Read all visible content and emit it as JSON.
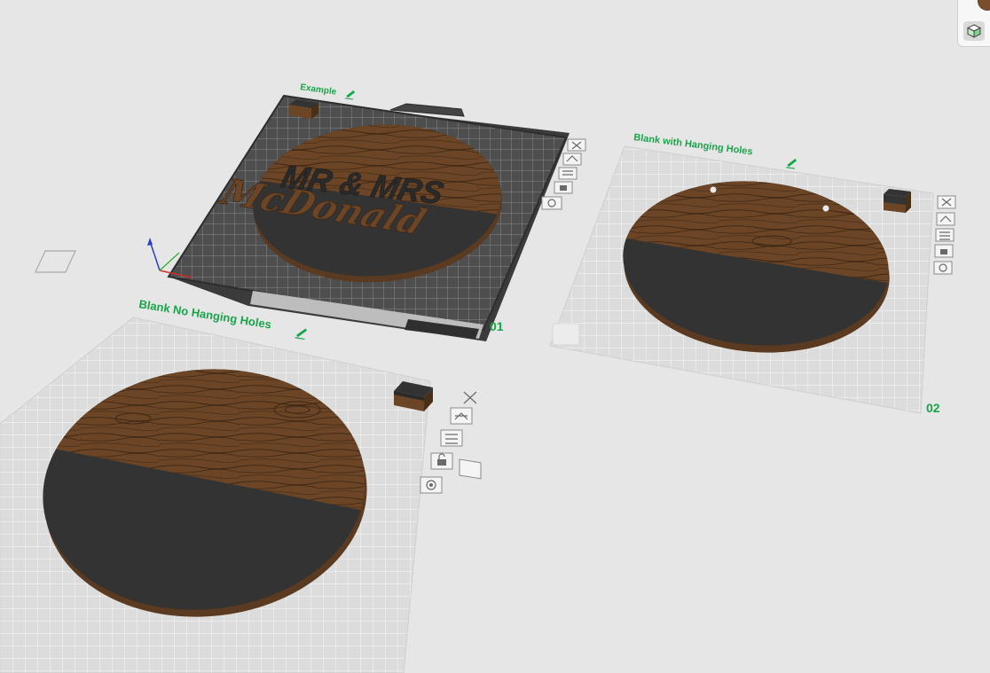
{
  "app": "3D slicer build plate view",
  "plates": [
    {
      "id": "plate-1",
      "label": "Example",
      "number": "01",
      "sign_text_line1": "MR & MRS",
      "sign_text_line2": "McDonald"
    },
    {
      "id": "plate-2",
      "label": "Blank with Hanging Holes",
      "number": "02"
    },
    {
      "id": "plate-3",
      "label": "Blank No Hanging Holes",
      "number": ""
    }
  ],
  "plate_tools": [
    "close-icon",
    "arrange-icon",
    "orient-icon",
    "lock-icon",
    "settings-icon"
  ],
  "icons": {
    "edit": "pencil-icon",
    "view": "cube-icon"
  },
  "colors": {
    "background": "#e6e6e6",
    "label": "#18a54a",
    "wood": "#6b4526",
    "wood_grain": "#3e2714",
    "slate": "#333333",
    "textured_bed": "#555555",
    "blank_bed": "#d8d8d8"
  }
}
